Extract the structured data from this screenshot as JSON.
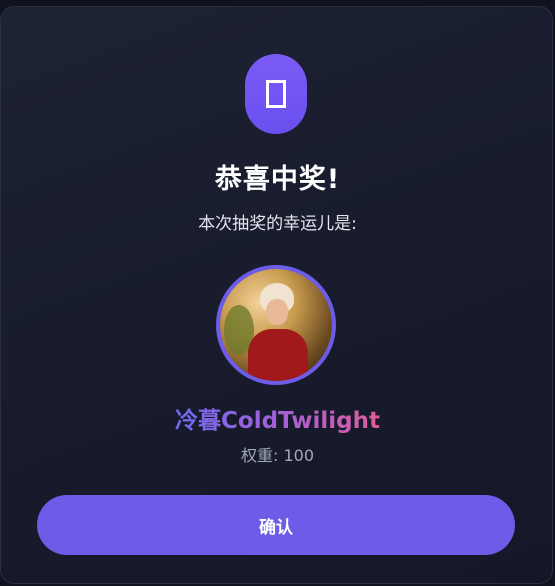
{
  "dialog": {
    "icon": "trophy-icon",
    "title": "恭喜中奖!",
    "subtitle": "本次抽奖的幸运儿是:",
    "winner": {
      "name": "冷暮ColdTwilight",
      "weight_text": "权重: 100"
    },
    "confirm_label": "确认"
  },
  "colors": {
    "accent": "#6c5ce7",
    "name_gradient_start": "#6f6af0",
    "name_gradient_end": "#e05c9c"
  }
}
